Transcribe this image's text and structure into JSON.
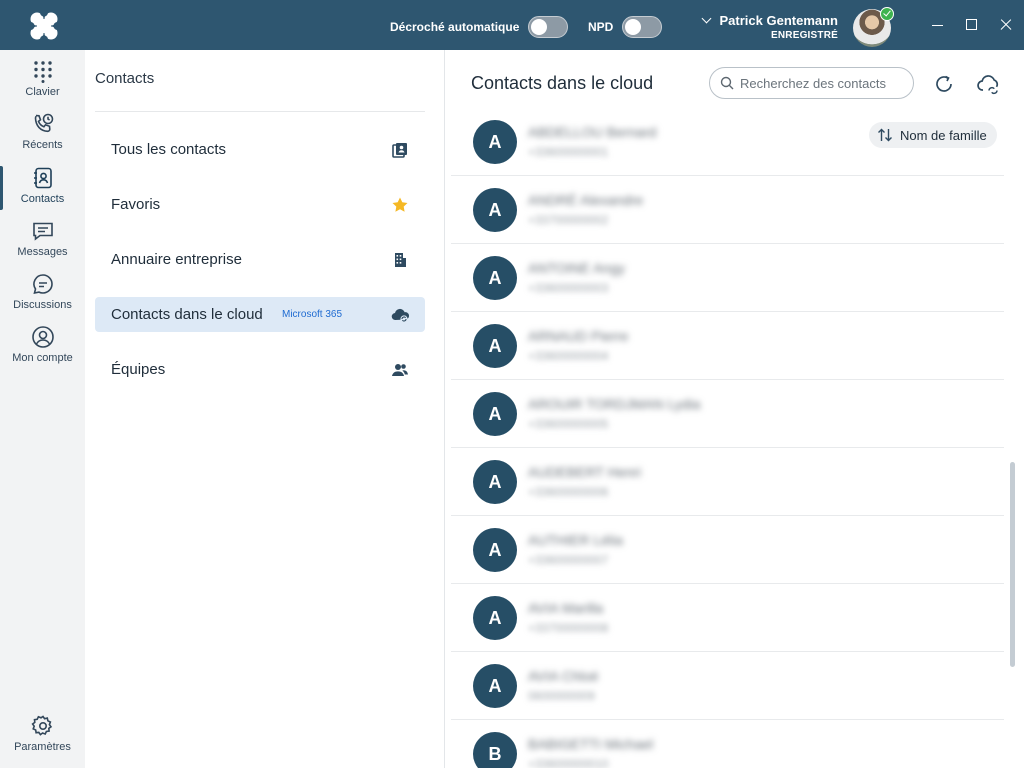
{
  "titlebar": {
    "auto_answer_label": "Décroché automatique",
    "auto_answer_on": false,
    "dnd_label": "NPD",
    "dnd_on": false,
    "user_name": "Patrick Gentemann",
    "user_status": "ENREGISTRÉ",
    "presence": "available"
  },
  "rail": {
    "items": [
      {
        "label": "Clavier",
        "icon": "dialpad-icon"
      },
      {
        "label": "Récents",
        "icon": "recent-calls-icon"
      },
      {
        "label": "Contacts",
        "icon": "contacts-book-icon"
      },
      {
        "label": "Messages",
        "icon": "messages-icon"
      },
      {
        "label": "Discussions",
        "icon": "chat-icon"
      },
      {
        "label": "Mon compte",
        "icon": "account-icon"
      }
    ],
    "active": "Contacts",
    "settings_label": "Paramètres"
  },
  "contacts_panel": {
    "title": "Contacts",
    "categories": [
      {
        "label": "Tous les contacts",
        "icon": "address-book-icon",
        "badge": ""
      },
      {
        "label": "Favoris",
        "icon": "star-icon",
        "badge": ""
      },
      {
        "label": "Annuaire entreprise",
        "icon": "building-icon",
        "badge": ""
      },
      {
        "label": "Contacts dans le cloud",
        "icon": "cloud-sync-icon",
        "badge": "Microsoft 365"
      },
      {
        "label": "Équipes",
        "icon": "team-icon",
        "badge": ""
      }
    ],
    "selected": "Contacts dans le cloud"
  },
  "main": {
    "title": "Contacts dans le cloud",
    "search_placeholder": "Recherchez des contacts",
    "sort_label": "Nom de famille",
    "contacts": [
      {
        "initial": "A",
        "name": "ABDELLOU Bernard",
        "number": "+33600000001"
      },
      {
        "initial": "A",
        "name": "ANDRÉ Alexandre",
        "number": "+33700000002"
      },
      {
        "initial": "A",
        "name": "ANTOINE Angy",
        "number": "+33600000003"
      },
      {
        "initial": "A",
        "name": "ARNAUD Pierre",
        "number": "+33600000004"
      },
      {
        "initial": "A",
        "name": "AROUIR TORDJMAN Lydia",
        "number": "+33600000005"
      },
      {
        "initial": "A",
        "name": "AUDEBERT Henri",
        "number": "+33600000006"
      },
      {
        "initial": "A",
        "name": "AUTHIER Lélia",
        "number": "+33600000007"
      },
      {
        "initial": "A",
        "name": "AVIA Marilla",
        "number": "+33700000008"
      },
      {
        "initial": "A",
        "name": "AVIA Chloé",
        "number": "0600000009"
      },
      {
        "initial": "B",
        "name": "BABIGETTI Michael",
        "number": "+33600000010"
      }
    ]
  },
  "colors": {
    "titlebar": "#2e5670",
    "avatar_bg": "#264e66",
    "selected_bg": "#dde9f6",
    "badge": "#1f6bd1",
    "star": "#f5b824"
  }
}
